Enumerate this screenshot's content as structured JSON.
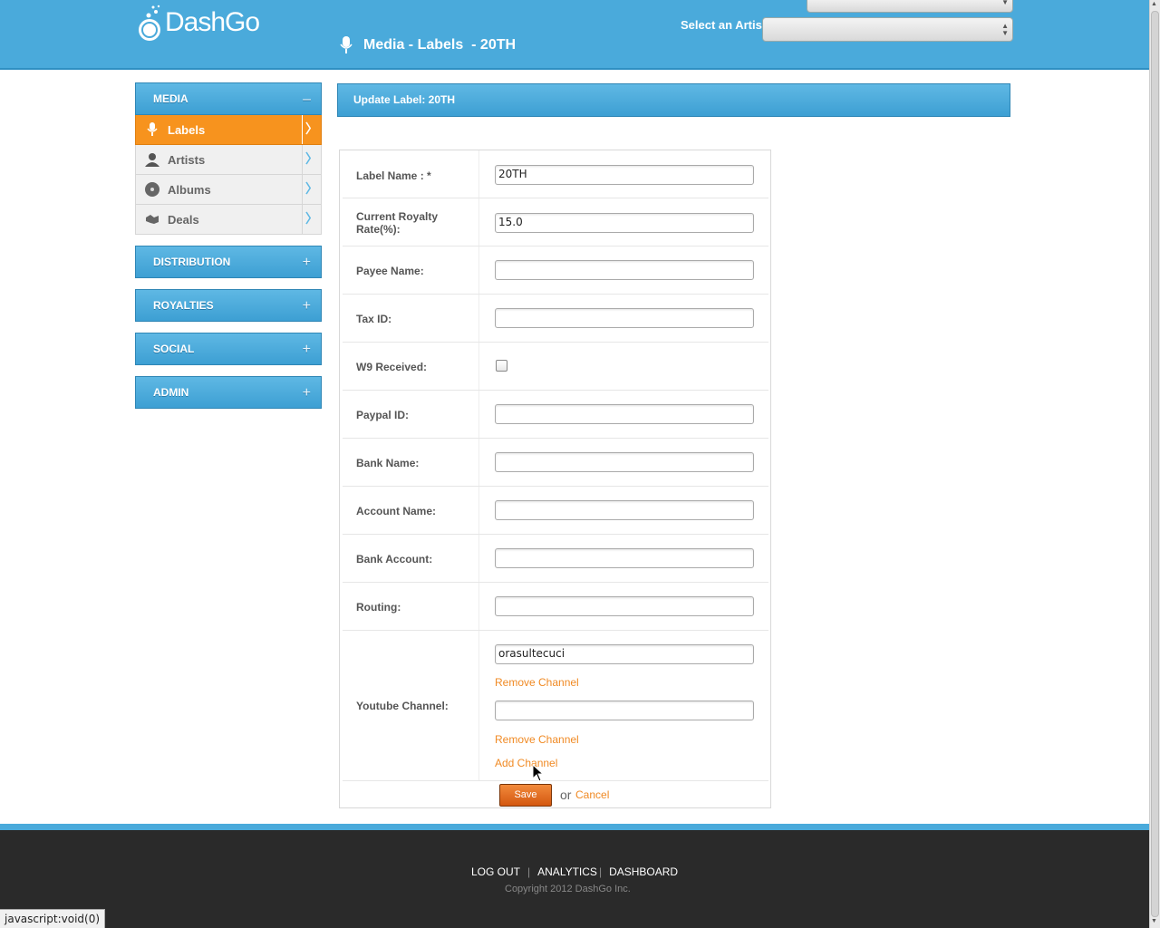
{
  "brand": {
    "name": "DashGo"
  },
  "header": {
    "page_title": "Media - Labels  - 20TH",
    "artist_label": "Select an Artist",
    "artist_value": "",
    "top_select_value": ""
  },
  "sidebar": {
    "media": {
      "label": "MEDIA",
      "toggle": "–"
    },
    "items": [
      {
        "label": "Labels",
        "icon": "microphone-icon",
        "active": true
      },
      {
        "label": "Artists",
        "icon": "person-icon"
      },
      {
        "label": "Albums",
        "icon": "disc-icon"
      },
      {
        "label": "Deals",
        "icon": "handshake-icon"
      }
    ],
    "sections": [
      {
        "label": "DISTRIBUTION",
        "toggle": "+"
      },
      {
        "label": "ROYALTIES",
        "toggle": "+"
      },
      {
        "label": "SOCIAL",
        "toggle": "+"
      },
      {
        "label": "ADMIN",
        "toggle": "+"
      }
    ]
  },
  "content": {
    "bar_title": "Update Label: 20TH"
  },
  "form": {
    "label_name": {
      "label": "Label Name : *",
      "value": "20TH"
    },
    "royalty": {
      "label": "Current Royalty Rate(%):",
      "value": "15.0"
    },
    "payee": {
      "label": "Payee Name:",
      "value": ""
    },
    "tax": {
      "label": "Tax ID:",
      "value": ""
    },
    "w9": {
      "label": "W9 Received:",
      "checked": false
    },
    "paypal": {
      "label": "Paypal ID:",
      "value": ""
    },
    "bank_name": {
      "label": "Bank Name:",
      "value": ""
    },
    "account_name": {
      "label": "Account Name:",
      "value": ""
    },
    "bank_account": {
      "label": "Bank Account:",
      "value": ""
    },
    "routing": {
      "label": "Routing:",
      "value": ""
    },
    "youtube": {
      "label": "Youtube Channel:",
      "channels": [
        "orasultecuci",
        ""
      ],
      "remove_label": "Remove Channel",
      "add_label": "Add Channel"
    },
    "save_label": "Save",
    "or_text": "or",
    "cancel_label": "Cancel"
  },
  "footer": {
    "logout": "LOG OUT",
    "analytics": "ANALYTICS",
    "dashboard": "DASHBOARD",
    "separator": "|",
    "copyright": "Copyright 2012 DashGo Inc."
  },
  "status_bar": "javascript:void(0)",
  "colors": {
    "header_blue": "#4aaadb",
    "accent_orange": "#f7931e",
    "link_orange": "#f08a24",
    "footer_dark": "#2a2a2a"
  }
}
